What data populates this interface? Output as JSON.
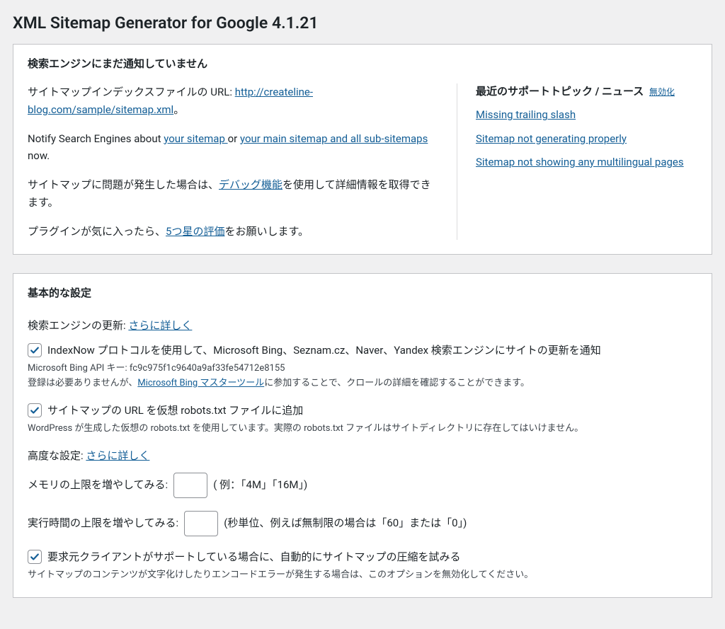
{
  "pageTitle": "XML Sitemap Generator for Google 4.1.21",
  "statusPanel": {
    "title": "検索エンジンにまだ通知していません",
    "urlPrefix": "サイトマップインデックスファイルの URL: ",
    "urlLink": "http://createline-blog.com/sample/sitemap.xml",
    "urlSuffix": "。",
    "notifyPrefix": "Notify Search Engines about ",
    "notifyYourSitemap": "your sitemap ",
    "notifyOr": "or ",
    "notifyMainSitemap": "your main sitemap and all sub-sitemaps",
    "notifySuffix": " now.",
    "debugPrefix": "サイトマップに問題が発生した場合は、",
    "debugLink": "デバッグ機能",
    "debugSuffix": "を使用して詳細情報を取得できます。",
    "ratingPrefix": "プラグインが気に入ったら、",
    "ratingLink": "5つ星の評価",
    "ratingSuffix": "をお願いします。",
    "newsHeading": "最近のサポートトピック / ニュース",
    "newsDisable": "無効化",
    "newsItems": [
      "Missing trailing slash",
      "Sitemap not generating properly",
      "Sitemap not showing any multilingual pages"
    ]
  },
  "basicPanel": {
    "title": "基本的な設定",
    "searchUpdateLabel": "検索エンジンの更新:",
    "learnMore": "さらに詳しく",
    "indexNowLabel": "IndexNow プロトコルを使用して、Microsoft Bing、Seznam.cz、Naver、Yandex 検索エンジンにサイトの更新を通知",
    "bingApiPrefix": "Microsoft Bing API キー: ",
    "bingApiKey": "fc9c975f1c9640a9af33fe54712e8155",
    "bingNotePrefix": "登録は必要ありませんが、",
    "bingNoteLink": "Microsoft Bing マスターツール",
    "bingNoteSuffix": "に参加することで、クロールの詳細を確認することができます。",
    "robotsLabel": "サイトマップの URL を仮想 robots.txt ファイルに追加",
    "robotsNote": "WordPress が生成した仮想の robots.txt を使用しています。実際の robots.txt ファイルはサイトディレクトリに存在してはいけません。",
    "advancedLabel": "高度な設定:",
    "memoryLabel": "メモリの上限を増やしてみる:",
    "memoryHint": "( 例：「4M」「16M」)",
    "execLabel": "実行時間の上限を増やしてみる:",
    "execHint": "(秒単位、例えば無制限の場合は「60」または「0」)",
    "compressLabel": "要求元クライアントがサポートしている場合に、自動的にサイトマップの圧縮を試みる",
    "compressNote": "サイトマップのコンテンツが文字化けしたりエンコードエラーが発生する場合は、このオプションを無効化してください。"
  }
}
